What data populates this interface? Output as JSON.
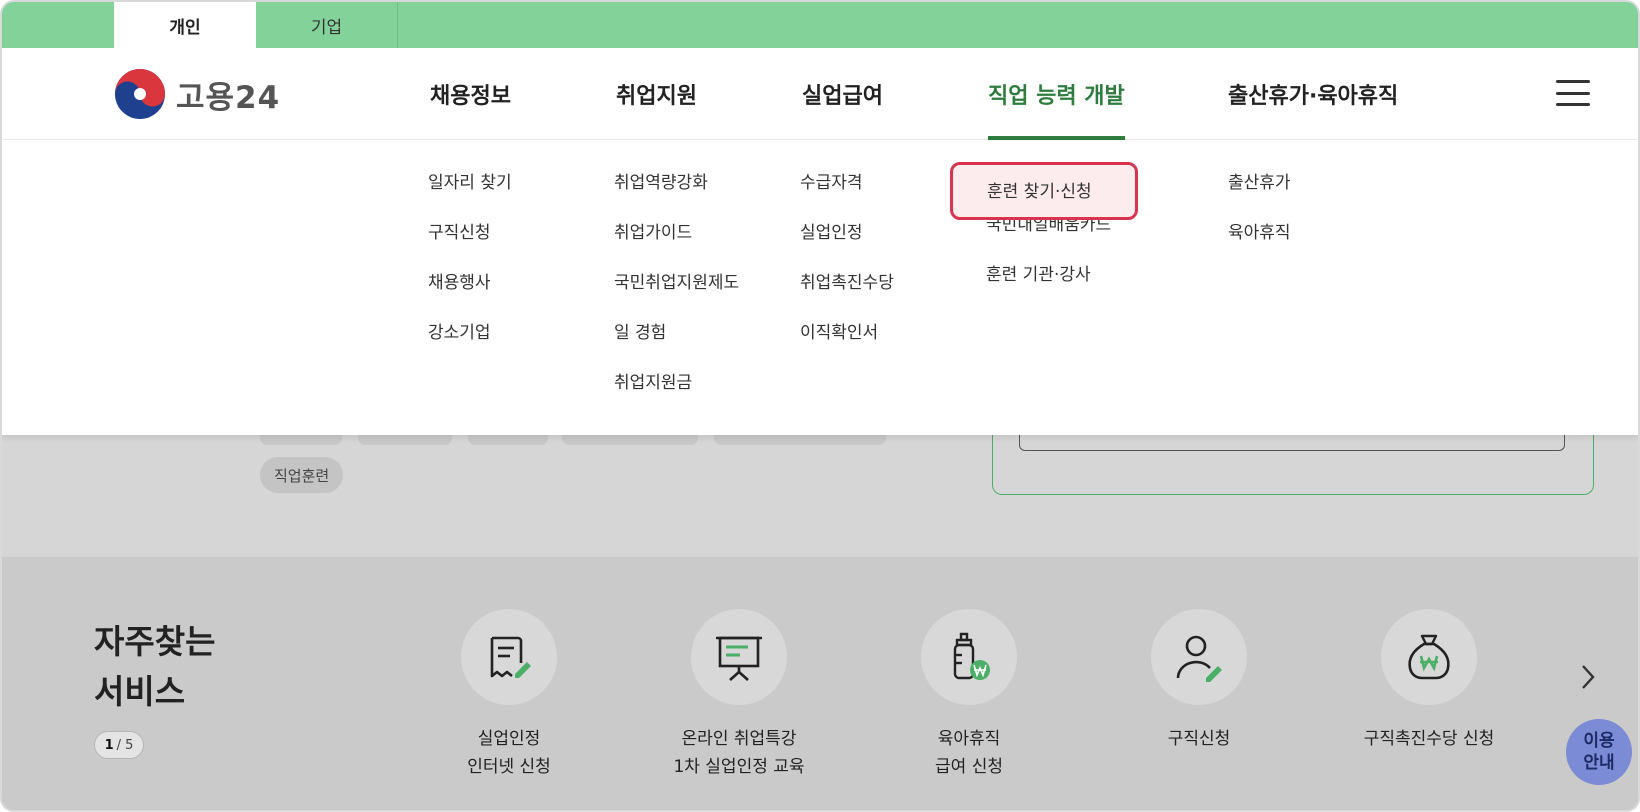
{
  "user_tabs": [
    {
      "label": "개인",
      "active": true
    },
    {
      "label": "기업",
      "active": false
    }
  ],
  "logo": {
    "text": "고용24",
    "icon": "taegeuk-icon"
  },
  "gnb": [
    {
      "label": "채용정보"
    },
    {
      "label": "취업지원"
    },
    {
      "label": "실업급여"
    },
    {
      "label": "직업 능력 개발",
      "active": true
    },
    {
      "label": "출산휴가·육아휴직"
    }
  ],
  "menu_icon": "hamburger-icon",
  "mega_menu": [
    [
      "일자리 찾기",
      "구직신청",
      "채용행사",
      "강소기업"
    ],
    [
      "취업역량강화",
      "취업가이드",
      "국민취업지원제도",
      "일 경험",
      "취업지원금"
    ],
    [
      "수급자격",
      "실업인정",
      "취업촉진수당",
      "이직확인서"
    ],
    [
      "훈련 찾기·신청",
      "국민내일배움카드",
      "훈련 기관·강사"
    ],
    [
      "출산휴가",
      "육아휴직"
    ]
  ],
  "highlighted_menu_item": "훈련 찾기·신청",
  "keyword_chip": "직업훈련",
  "frequent_services": {
    "title_line1": "자주찾는",
    "title_line2": "서비스",
    "pager_current": "1",
    "pager_total": "/ 5",
    "items": [
      {
        "line1": "실업인정",
        "line2": "인터넷 신청",
        "icon": "document-edit-icon"
      },
      {
        "line1": "온라인 취업특강",
        "line2": "1차 실업인정 교육",
        "icon": "presentation-board-icon"
      },
      {
        "line1": "육아휴직",
        "line2": "급여 신청",
        "icon": "baby-bottle-won-icon"
      },
      {
        "line1": "구직신청",
        "line2": "",
        "icon": "person-edit-icon"
      },
      {
        "line1": "구직촉진수당 신청",
        "line2": "",
        "icon": "money-bag-won-icon"
      }
    ]
  },
  "help_button": {
    "line1": "이용",
    "line2": "안내"
  },
  "colors": {
    "top_bar": "#82d29a",
    "active_nav": "#2e7d3f",
    "highlight_border": "#d8344f",
    "highlight_bg": "#fdecee",
    "help_button": "#7b8bd6"
  }
}
